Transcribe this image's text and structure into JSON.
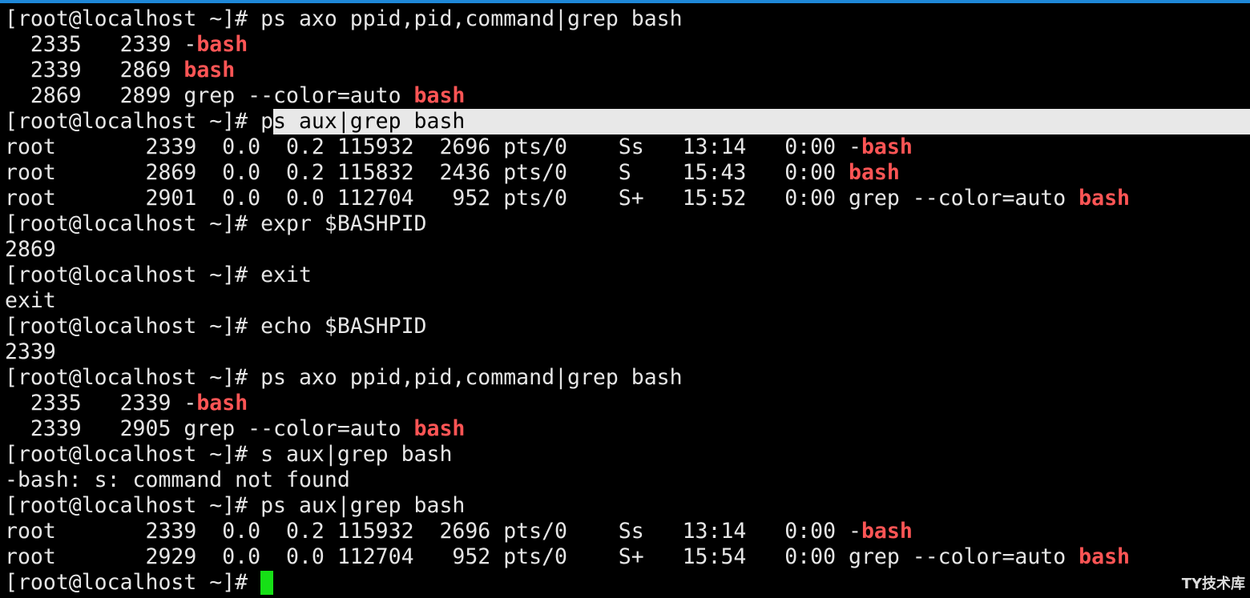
{
  "lines": [
    {
      "id": "l01",
      "parts": [
        {
          "t": "[root@localhost ~]# ps axo ppid,pid,command|grep bash"
        }
      ]
    },
    {
      "id": "l02",
      "parts": [
        {
          "t": "  2335   2339 -"
        },
        {
          "t": "bash",
          "hl": true
        }
      ]
    },
    {
      "id": "l03",
      "parts": [
        {
          "t": "  2339   2869 "
        },
        {
          "t": "bash",
          "hl": true
        }
      ]
    },
    {
      "id": "l04",
      "parts": [
        {
          "t": "  2869   2899 grep --color=auto "
        },
        {
          "t": "bash",
          "hl": true
        }
      ]
    },
    {
      "id": "l05",
      "selected": true,
      "parts": [
        {
          "t": "[root@localhost ~]# p"
        },
        {
          "t": "s aux|grep bash",
          "sel": true
        }
      ]
    },
    {
      "id": "l06",
      "parts": [
        {
          "t": "root       2339  0.0  0.2 115932  2696 pts/0    Ss   13:14   0:00 -"
        },
        {
          "t": "bash",
          "hl": true
        }
      ]
    },
    {
      "id": "l07",
      "parts": [
        {
          "t": "root       2869  0.0  0.2 115832  2436 pts/0    S    15:43   0:00 "
        },
        {
          "t": "bash",
          "hl": true
        }
      ]
    },
    {
      "id": "l08",
      "parts": [
        {
          "t": "root       2901  0.0  0.0 112704   952 pts/0    S+   15:52   0:00 grep --color=auto "
        },
        {
          "t": "bash",
          "hl": true
        }
      ]
    },
    {
      "id": "l09",
      "parts": [
        {
          "t": "[root@localhost ~]# expr $BASHPID"
        }
      ]
    },
    {
      "id": "l10",
      "parts": [
        {
          "t": "2869"
        }
      ]
    },
    {
      "id": "l11",
      "parts": [
        {
          "t": "[root@localhost ~]# exit"
        }
      ]
    },
    {
      "id": "l12",
      "parts": [
        {
          "t": "exit"
        }
      ]
    },
    {
      "id": "l13",
      "parts": [
        {
          "t": "[root@localhost ~]# echo $BASHPID"
        }
      ]
    },
    {
      "id": "l14",
      "parts": [
        {
          "t": "2339"
        }
      ]
    },
    {
      "id": "l15",
      "parts": [
        {
          "t": "[root@localhost ~]# ps axo ppid,pid,command|grep bash"
        }
      ]
    },
    {
      "id": "l16",
      "parts": [
        {
          "t": "  2335   2339 -"
        },
        {
          "t": "bash",
          "hl": true
        }
      ]
    },
    {
      "id": "l17",
      "parts": [
        {
          "t": "  2339   2905 grep --color=auto "
        },
        {
          "t": "bash",
          "hl": true
        }
      ]
    },
    {
      "id": "l18",
      "parts": [
        {
          "t": "[root@localhost ~]# s aux|grep bash"
        }
      ]
    },
    {
      "id": "l19",
      "parts": [
        {
          "t": "-bash: s: command not found"
        }
      ]
    },
    {
      "id": "l20",
      "parts": [
        {
          "t": "[root@localhost ~]# ps aux|grep bash"
        }
      ]
    },
    {
      "id": "l21",
      "parts": [
        {
          "t": "root       2339  0.0  0.2 115932  2696 pts/0    Ss   13:14   0:00 -"
        },
        {
          "t": "bash",
          "hl": true
        }
      ]
    },
    {
      "id": "l22",
      "parts": [
        {
          "t": "root       2929  0.0  0.0 112704   952 pts/0    S+   15:54   0:00 grep --color=auto "
        },
        {
          "t": "bash",
          "hl": true
        }
      ]
    },
    {
      "id": "l23",
      "prompt": true,
      "parts": [
        {
          "t": "[root@localhost ~]# "
        }
      ]
    }
  ],
  "watermark": "TY技术库",
  "colors": {
    "background": "#000000",
    "text": "#e6e6e6",
    "highlight": "#ff5555",
    "cursor": "#16e016",
    "selection": "#e8e8e8",
    "accent": "#1e88d8"
  }
}
